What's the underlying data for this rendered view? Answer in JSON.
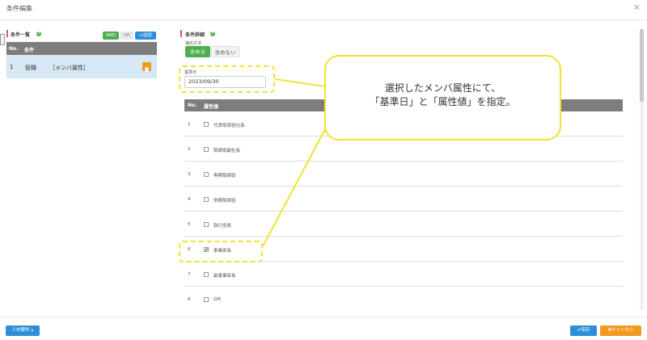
{
  "dialog": {
    "title": "条件編集",
    "close_icon": "✕"
  },
  "left_panel": {
    "heading": "条件一覧",
    "and_label": "AND",
    "or_label": "OR",
    "add_label": "+追加",
    "columns": [
      "No.",
      "条件"
    ],
    "rows": [
      {
        "no": "1",
        "name": "役職",
        "type": "［メンバ属性］"
      }
    ]
  },
  "right_panel": {
    "heading": "条件詳細",
    "extract_label": "抽出方法",
    "include_label": "含める",
    "exclude_label": "含めない",
    "date_label": "基準日",
    "date_value": "2023/09/30",
    "columns": [
      "No.",
      "属性値"
    ],
    "rows": [
      {
        "no": "1",
        "label": "代表取締役社長",
        "checked": false
      },
      {
        "no": "2",
        "label": "取締役副社長",
        "checked": false
      },
      {
        "no": "3",
        "label": "専務取締役",
        "checked": false
      },
      {
        "no": "4",
        "label": "常務取締役",
        "checked": false
      },
      {
        "no": "5",
        "label": "執行役員",
        "checked": false
      },
      {
        "no": "6",
        "label": "事業部長",
        "checked": true
      },
      {
        "no": "7",
        "label": "副事業部長",
        "checked": false
      },
      {
        "no": "8",
        "label": "GM",
        "checked": false
      }
    ]
  },
  "callout": {
    "line1": "選択したメンバ属性にて、",
    "line2": "「基準日」と「属性値」を指定。"
  },
  "footer": {
    "hr_label": "人材要件 ▴",
    "save_label": "✔保存",
    "cancel_label": "✖キャンセル"
  },
  "colors": {
    "accent_green": "#4cae4c",
    "accent_blue": "#2e8fd8",
    "accent_orange": "#f29a1d",
    "highlight_yellow": "#f2e330",
    "selected_row": "#d6e7f5"
  }
}
